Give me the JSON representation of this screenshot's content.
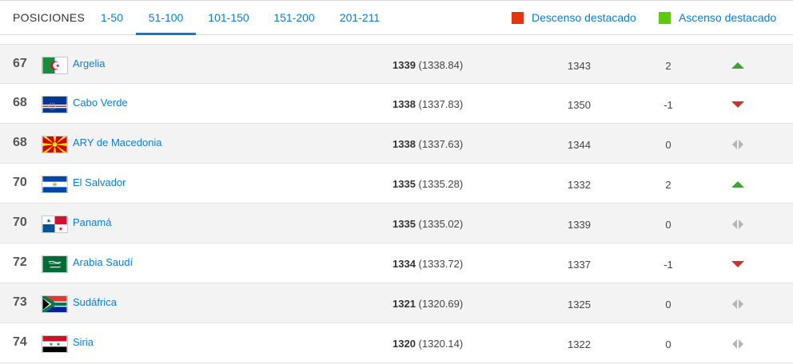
{
  "tabs_label": "POSICIONES",
  "tabs": [
    {
      "label": "1-50",
      "active": false
    },
    {
      "label": "51-100",
      "active": true
    },
    {
      "label": "101-150",
      "active": false
    },
    {
      "label": "151-200",
      "active": false
    },
    {
      "label": "201-211",
      "active": false
    }
  ],
  "legend": {
    "descenso": {
      "label": "Descenso destacado",
      "color": "#e0390f"
    },
    "ascenso": {
      "label": "Ascenso destacado",
      "color": "#5ec90f"
    }
  },
  "rows": [
    {
      "rank": "67",
      "team": "Argelia",
      "flag": "algeria-flag",
      "pts": "1339",
      "pts_exact": "(1338.84)",
      "prev_pts": "1343",
      "change": "2",
      "trend": "up"
    },
    {
      "rank": "68",
      "team": "Cabo Verde",
      "flag": "cape-verde-flag",
      "pts": "1338",
      "pts_exact": "(1337.83)",
      "prev_pts": "1350",
      "change": "-1",
      "trend": "down"
    },
    {
      "rank": "68",
      "team": "ARY de Macedonia",
      "flag": "macedonia-flag",
      "pts": "1338",
      "pts_exact": "(1337.63)",
      "prev_pts": "1344",
      "change": "0",
      "trend": "same"
    },
    {
      "rank": "70",
      "team": "El Salvador",
      "flag": "el-salvador-flag",
      "pts": "1335",
      "pts_exact": "(1335.28)",
      "prev_pts": "1332",
      "change": "2",
      "trend": "up"
    },
    {
      "rank": "70",
      "team": "Panamá",
      "flag": "panama-flag",
      "pts": "1335",
      "pts_exact": "(1335.02)",
      "prev_pts": "1339",
      "change": "0",
      "trend": "same"
    },
    {
      "rank": "72",
      "team": "Arabia Saudí",
      "flag": "saudi-arabia-flag",
      "pts": "1334",
      "pts_exact": "(1333.72)",
      "prev_pts": "1337",
      "change": "-1",
      "trend": "down"
    },
    {
      "rank": "73",
      "team": "Sudáfrica",
      "flag": "south-africa-flag",
      "pts": "1321",
      "pts_exact": "(1320.69)",
      "prev_pts": "1325",
      "change": "0",
      "trend": "same"
    },
    {
      "rank": "74",
      "team": "Siria",
      "flag": "syria-flag",
      "pts": "1320",
      "pts_exact": "(1320.14)",
      "prev_pts": "1322",
      "change": "0",
      "trend": "same"
    }
  ],
  "colors": {
    "link": "#0a7cd8",
    "up": "#3aa533",
    "down": "#c9342f",
    "same": "#b5b5b5"
  }
}
